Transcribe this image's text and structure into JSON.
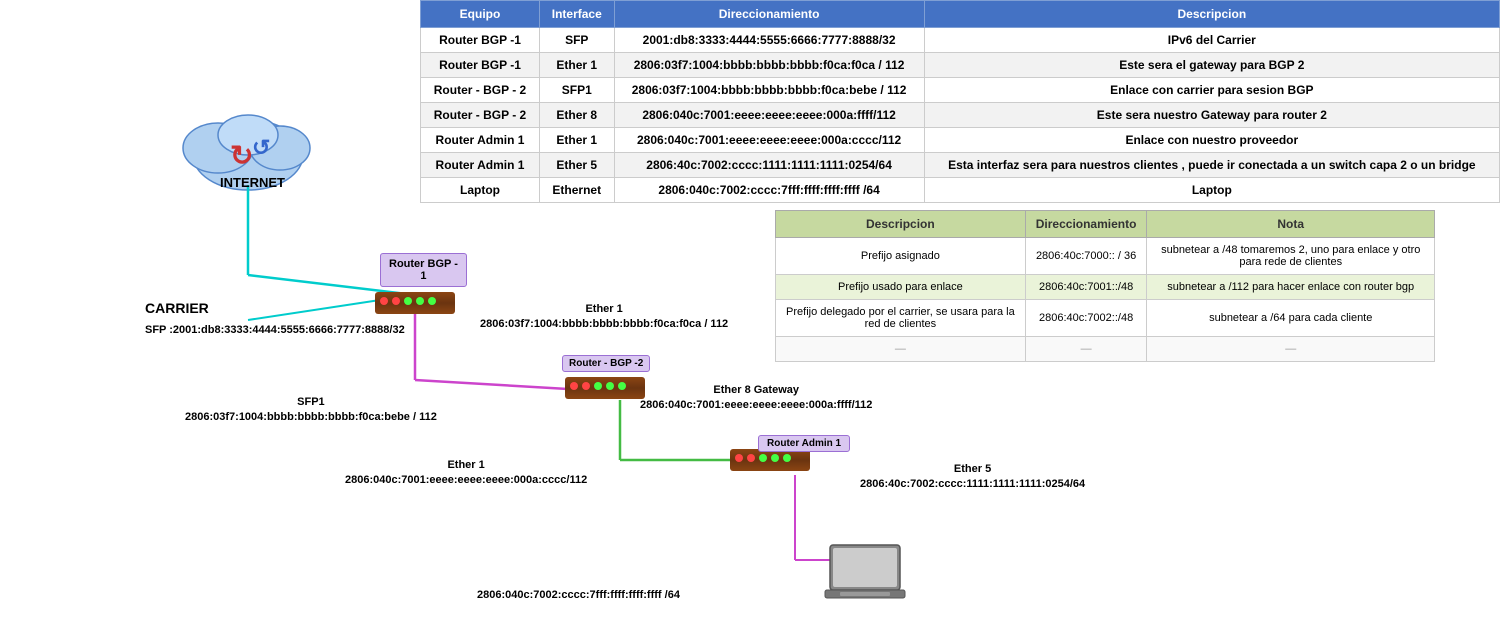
{
  "table1": {
    "headers": [
      "Equipo",
      "Interface",
      "Direccionamiento",
      "Descripcion"
    ],
    "rows": [
      [
        "Router BGP -1",
        "SFP",
        "2001:db8:3333:4444:5555:6666:7777:8888/32",
        "IPv6 del Carrier"
      ],
      [
        "Router BGP -1",
        "Ether 1",
        "2806:03f7:1004:bbbb:bbbb:bbbb:f0ca:f0ca / 112",
        "Este sera el gateway para BGP 2"
      ],
      [
        "Router - BGP - 2",
        "SFP1",
        "2806:03f7:1004:bbbb:bbbb:bbbb:f0ca:bebe / 112",
        "Enlace con carrier para sesion BGP"
      ],
      [
        "Router - BGP - 2",
        "Ether 8",
        "2806:040c:7001:eeee:eeee:eeee:000a:ffff/112",
        "Este sera nuestro Gateway para router 2"
      ],
      [
        "Router Admin 1",
        "Ether 1",
        "2806:040c:7001:eeee:eeee:eeee:000a:cccc/112",
        "Enlace con nuestro proveedor"
      ],
      [
        "Router Admin 1",
        "Ether 5",
        "2806:40c:7002:cccc:1111:1111:1111:0254/64",
        "Esta interfaz sera para nuestros clientes , puede ir conectada a un switch capa 2 o un bridge"
      ],
      [
        "Laptop",
        "Ethernet",
        "2806:040c:7002:cccc:7fff:ffff:ffff:ffff /64",
        "Laptop"
      ]
    ]
  },
  "table2": {
    "headers": [
      "Descripcion",
      "Direccionamiento",
      "Nota"
    ],
    "rows": [
      [
        "Prefijo asignado",
        "2806:40c:7000:: / 36",
        "subnetear a /48  tomaremos 2, uno para enlace y otro para rede de clientes"
      ],
      [
        "Prefijo usado para enlace",
        "2806:40c:7001::/48",
        "subnetear a /112 para hacer enlace con router bgp"
      ],
      [
        "Prefijo delegado por el carrier, se usara para la red de clientes",
        "2806:40c:7002::/48",
        "subnetear a /64 para cada cliente"
      ],
      [
        "—",
        "—",
        "—"
      ]
    ]
  },
  "diagram": {
    "internet_label": "INTERNET",
    "carrier_label": "CARRIER",
    "carrier_sfp": "SFP :2001:db8:3333:4444:5555:6666:7777:8888/32",
    "router_bgp1_label": "Router BGP -\n1",
    "ether1_label": "Ether 1",
    "ether1_addr": "2806:03f7:1004:bbbb:bbbb:bbbb:f0ca:f0ca / 112",
    "router_bgp2_label": "Router - BGP -2",
    "sfp1_label": "SFP1",
    "sfp1_addr": "2806:03f7:1004:bbbb:bbbb:bbbb:f0ca:bebe / 112",
    "ether8_label": "Ether 8 Gateway",
    "ether8_addr": "2806:040c:7001:eeee:eeee:eeee:000a:ffff/112",
    "router_admin1_label": "Router Admin 1",
    "ether1b_label": "Ether 1",
    "ether1b_addr": "2806:040c:7001:eeee:eeee:eeee:000a:cccc/112",
    "ether5_label": "Ether 5",
    "ether5_addr": "2806:40c:7002:cccc:1111:1111:1111:0254/64",
    "laptop_addr": "2806:040c:7002:cccc:7fff:ffff:ffff:ffff /64"
  }
}
